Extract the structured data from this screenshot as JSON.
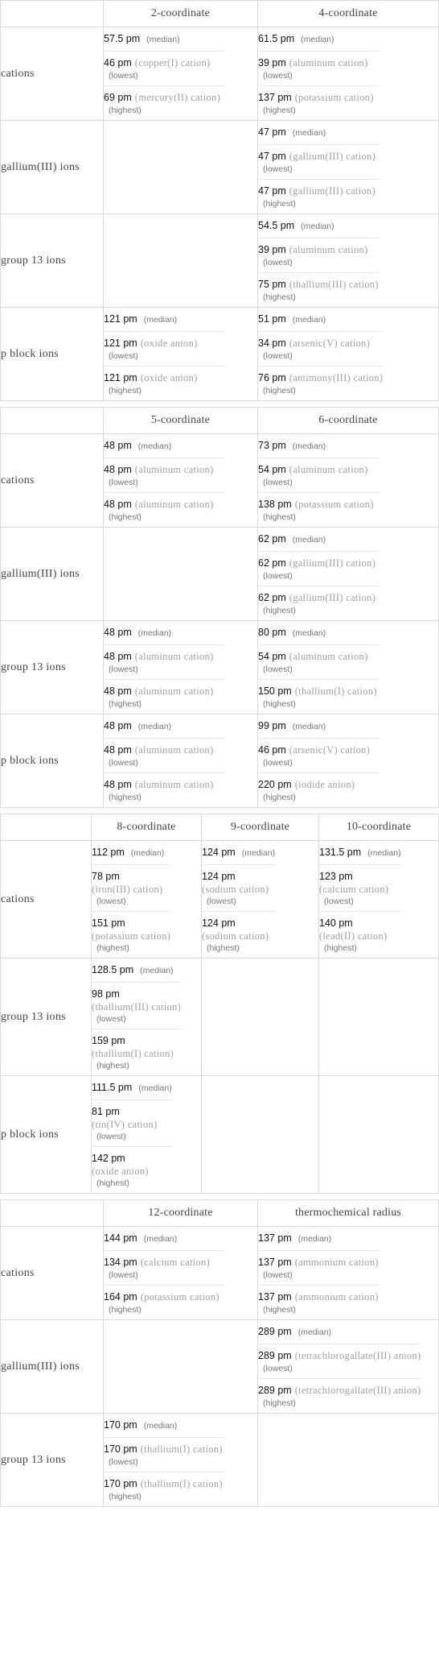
{
  "tables": [
    {
      "columns": [
        "2-coordinate",
        "4-coordinate"
      ],
      "rows": [
        {
          "label": "cations",
          "cells": [
            {
              "median": "57.5 pm",
              "lowest": {
                "value": "46 pm",
                "ion": "(copper(I) cation)"
              },
              "highest": {
                "value": "69 pm",
                "ion": "(mercury(II) cation)"
              }
            },
            {
              "median": "61.5 pm",
              "lowest": {
                "value": "39 pm",
                "ion": "(aluminum cation)"
              },
              "highest": {
                "value": "137 pm",
                "ion": "(potassium cation)"
              }
            }
          ]
        },
        {
          "label": "gallium(III) ions",
          "cells": [
            null,
            {
              "median": "47 pm",
              "lowest": {
                "value": "47 pm",
                "ion": "(gallium(III) cation)"
              },
              "highest": {
                "value": "47 pm",
                "ion": "(gallium(III) cation)"
              }
            }
          ]
        },
        {
          "label": "group 13 ions",
          "cells": [
            null,
            {
              "median": "54.5 pm",
              "lowest": {
                "value": "39 pm",
                "ion": "(aluminum cation)"
              },
              "highest": {
                "value": "75 pm",
                "ion": "(thallium(III) cation)"
              }
            }
          ]
        },
        {
          "label": "p block ions",
          "cells": [
            {
              "median": "121 pm",
              "lowest": {
                "value": "121 pm",
                "ion": "(oxide anion)"
              },
              "highest": {
                "value": "121 pm",
                "ion": "(oxide anion)"
              }
            },
            {
              "median": "51 pm",
              "lowest": {
                "value": "34 pm",
                "ion": "(arsenic(V) cation)"
              },
              "highest": {
                "value": "76 pm",
                "ion": "(antimony(III) cation)"
              }
            }
          ]
        }
      ]
    },
    {
      "columns": [
        "5-coordinate",
        "6-coordinate"
      ],
      "rows": [
        {
          "label": "cations",
          "cells": [
            {
              "median": "48 pm",
              "lowest": {
                "value": "48 pm",
                "ion": "(aluminum cation)"
              },
              "highest": {
                "value": "48 pm",
                "ion": "(aluminum cation)"
              }
            },
            {
              "median": "73 pm",
              "lowest": {
                "value": "54 pm",
                "ion": "(aluminum cation)"
              },
              "highest": {
                "value": "138 pm",
                "ion": "(potassium cation)"
              }
            }
          ]
        },
        {
          "label": "gallium(III) ions",
          "cells": [
            null,
            {
              "median": "62 pm",
              "lowest": {
                "value": "62 pm",
                "ion": "(gallium(III) cation)"
              },
              "highest": {
                "value": "62 pm",
                "ion": "(gallium(III) cation)"
              }
            }
          ]
        },
        {
          "label": "group 13 ions",
          "cells": [
            {
              "median": "48 pm",
              "lowest": {
                "value": "48 pm",
                "ion": "(aluminum cation)"
              },
              "highest": {
                "value": "48 pm",
                "ion": "(aluminum cation)"
              }
            },
            {
              "median": "80 pm",
              "lowest": {
                "value": "54 pm",
                "ion": "(aluminum cation)"
              },
              "highest": {
                "value": "150 pm",
                "ion": "(thallium(I) cation)"
              }
            }
          ]
        },
        {
          "label": "p block ions",
          "cells": [
            {
              "median": "48 pm",
              "lowest": {
                "value": "48 pm",
                "ion": "(aluminum cation)"
              },
              "highest": {
                "value": "48 pm",
                "ion": "(aluminum cation)"
              }
            },
            {
              "median": "99 pm",
              "lowest": {
                "value": "46 pm",
                "ion": "(arsenic(V) cation)"
              },
              "highest": {
                "value": "220 pm",
                "ion": "(iodide anion)"
              }
            }
          ]
        }
      ]
    },
    {
      "columns": [
        "8-coordinate",
        "9-coordinate",
        "10-coordinate"
      ],
      "rows": [
        {
          "label": "cations",
          "cells": [
            {
              "median": "112 pm",
              "lowest": {
                "value": "78 pm",
                "ion": "(iron(III) cation)"
              },
              "highest": {
                "value": "151 pm",
                "ion": "(potassium cation)"
              }
            },
            {
              "median": "124 pm",
              "lowest": {
                "value": "124 pm",
                "ion": "(sodium cation)"
              },
              "highest": {
                "value": "124 pm",
                "ion": "(sodium cation)"
              }
            },
            {
              "median": "131.5 pm",
              "lowest": {
                "value": "123 pm",
                "ion": "(calcium cation)"
              },
              "highest": {
                "value": "140 pm",
                "ion": "(lead(II) cation)"
              }
            }
          ]
        },
        {
          "label": "group 13 ions",
          "cells": [
            {
              "median": "128.5 pm",
              "lowest": {
                "value": "98 pm",
                "ion": "(thallium(III) cation)"
              },
              "highest": {
                "value": "159 pm",
                "ion": "(thallium(I) cation)"
              }
            },
            null,
            null
          ]
        },
        {
          "label": "p block ions",
          "cells": [
            {
              "median": "111.5 pm",
              "lowest": {
                "value": "81 pm",
                "ion": "(tin(IV) cation)"
              },
              "highest": {
                "value": "142 pm",
                "ion": "(oxide anion)"
              }
            },
            null,
            null
          ]
        }
      ]
    },
    {
      "columns": [
        "12-coordinate",
        "thermochemical radius"
      ],
      "rows": [
        {
          "label": "cations",
          "cells": [
            {
              "median": "144 pm",
              "lowest": {
                "value": "134 pm",
                "ion": "(calcium cation)"
              },
              "highest": {
                "value": "164 pm",
                "ion": "(potassium cation)"
              }
            },
            {
              "median": "137 pm",
              "lowest": {
                "value": "137 pm",
                "ion": "(ammonium cation)"
              },
              "highest": {
                "value": "137 pm",
                "ion": "(ammonium cation)"
              }
            }
          ]
        },
        {
          "label": "gallium(III) ions",
          "cells": [
            null,
            {
              "median": "289 pm",
              "lowest": {
                "value": "289 pm",
                "ion": "(tetrachlorogallate(III) anion)"
              },
              "highest": {
                "value": "289 pm",
                "ion": "(tetrachlorogallate(III) anion)"
              }
            }
          ]
        },
        {
          "label": "group 13 ions",
          "cells": [
            {
              "median": "170 pm",
              "lowest": {
                "value": "170 pm",
                "ion": "(thallium(I) cation)"
              },
              "highest": {
                "value": "170 pm",
                "ion": "(thallium(I) cation)"
              }
            },
            null
          ]
        }
      ]
    }
  ],
  "labels": {
    "median": "(median)",
    "lowest": "(lowest)",
    "highest": "(highest)"
  }
}
